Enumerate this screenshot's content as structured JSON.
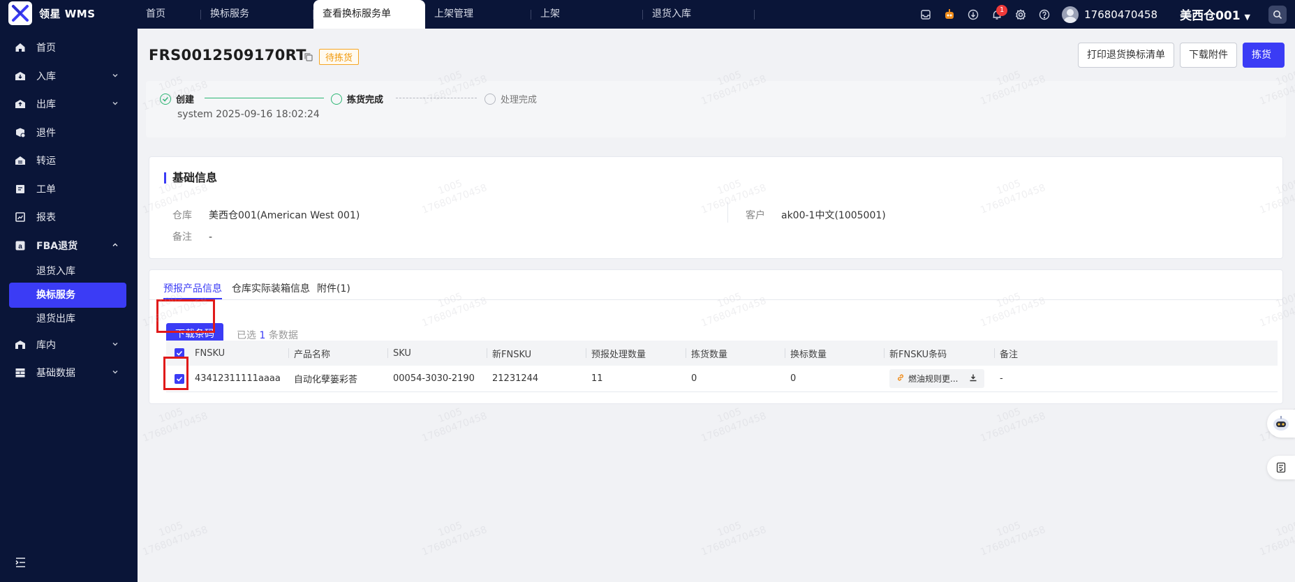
{
  "app": {
    "logo_text": "领星 WMS"
  },
  "tabs": [
    {
      "label": "首页"
    },
    {
      "label": "换标服务"
    },
    {
      "label": "查看换标服务单"
    },
    {
      "label": "上架管理"
    },
    {
      "label": "上架"
    },
    {
      "label": "退货入库"
    }
  ],
  "header": {
    "notification_count": "1",
    "user_name": "17680470458",
    "warehouse": "美西仓001"
  },
  "sidebar": {
    "items": [
      {
        "label": "首页"
      },
      {
        "label": "入库"
      },
      {
        "label": "出库"
      },
      {
        "label": "退件"
      },
      {
        "label": "转运"
      },
      {
        "label": "工单"
      },
      {
        "label": "报表"
      },
      {
        "label": "FBA退货"
      },
      {
        "label": "库内"
      },
      {
        "label": "基础数据"
      }
    ],
    "fba_sub": [
      {
        "label": "退货入库"
      },
      {
        "label": "换标服务"
      },
      {
        "label": "退货出库"
      }
    ]
  },
  "page": {
    "order_no": "FRS0012509170RT",
    "status": "待拣货",
    "buttons": {
      "print": "打印退货换标清单",
      "download_attachment": "下载附件",
      "pick": "拣货"
    }
  },
  "progress": {
    "steps": [
      {
        "label": "创建",
        "state": "done"
      },
      {
        "label": "拣货完成",
        "state": "current"
      },
      {
        "label": "处理完成",
        "state": "pending"
      }
    ],
    "created_info": "system 2025-09-16 18:02:24"
  },
  "basic_info": {
    "title": "基础信息",
    "warehouse_label": "仓库",
    "warehouse_value": "美西仓001(American West 001)",
    "customer_label": "客户",
    "customer_value": "ak00-1中文(1005001)",
    "remark_label": "备注",
    "remark_value": "-"
  },
  "product_tabs": [
    {
      "label": "预报产品信息"
    },
    {
      "label": "仓库实际装箱信息"
    },
    {
      "label": "附件(1)"
    }
  ],
  "actions": {
    "download_barcode": "下载条码",
    "selected_prefix": "已选",
    "selected_count": "1",
    "selected_suffix": "条数据"
  },
  "table": {
    "columns": [
      "FNSKU",
      "产品名称",
      "SKU",
      "新FNSKU",
      "预报处理数量",
      "拣货数量",
      "换标数量",
      "新FNSKU条码",
      "备注"
    ],
    "rows": [
      {
        "fnsku": "43412311111aaaa",
        "name": "自动化孽篓彩荅",
        "sku": "00054-3030-2190",
        "new_fnsku": "21231244",
        "forecast_qty": "11",
        "pick_qty": "0",
        "relabel_qty": "0",
        "barcode_file": "燃油规则更...",
        "remark": "-"
      }
    ]
  },
  "watermark": {
    "line1": "1005",
    "line2": "17680470458"
  },
  "colors": {
    "primary": "#3b3cf5",
    "nav_bg": "#0a1538",
    "success": "#2bb673",
    "warning": "#f5a623",
    "highlight": "#e01a1a"
  }
}
